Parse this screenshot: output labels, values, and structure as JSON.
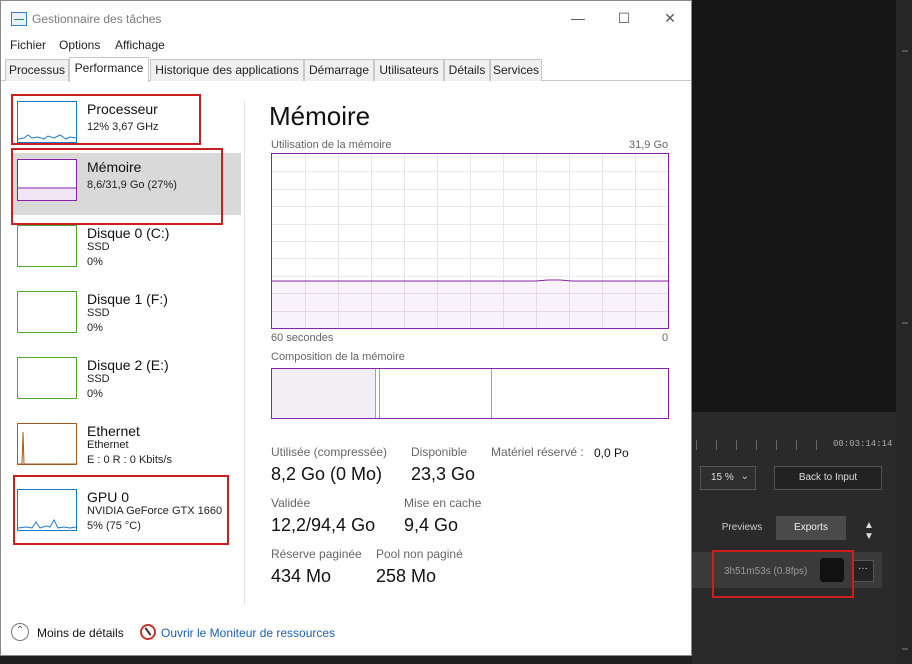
{
  "window": {
    "title": "Gestionnaire des tâches",
    "controls": {
      "minimize": "—",
      "maximize": "☐",
      "close": "✕"
    }
  },
  "menu": [
    "Fichier",
    "Options",
    "Affichage"
  ],
  "tabs": [
    {
      "label": "Processus",
      "active": false
    },
    {
      "label": "Performance",
      "active": true
    },
    {
      "label": "Historique des applications",
      "active": false
    },
    {
      "label": "Démarrage",
      "active": false
    },
    {
      "label": "Utilisateurs",
      "active": false
    },
    {
      "label": "Détails",
      "active": false
    },
    {
      "label": "Services",
      "active": false
    }
  ],
  "sidebar": {
    "items": [
      {
        "title": "Processeur",
        "line1": "12% 3,67 GHz",
        "line2": "",
        "line3": "",
        "color": "#1b7ac6"
      },
      {
        "title": "Mémoire",
        "line1": "8,6/31,9 Go (27%)",
        "line2": "",
        "line3": "",
        "color": "#8c1fa6"
      },
      {
        "title": "Disque 0 (C:)",
        "line1": "SSD",
        "line2": "0%",
        "line3": "",
        "color": "#4ea72e"
      },
      {
        "title": "Disque 1 (F:)",
        "line1": "SSD",
        "line2": "0%",
        "line3": "",
        "color": "#4ea72e"
      },
      {
        "title": "Disque 2 (E:)",
        "line1": "SSD",
        "line2": "0%",
        "line3": "",
        "color": "#4ea72e"
      },
      {
        "title": "Ethernet",
        "line1": "Ethernet",
        "line2": "E : 0 R : 0 Kbits/s",
        "line3": "",
        "color": "#a7591e"
      },
      {
        "title": "GPU 0",
        "line1": "NVIDIA GeForce GTX 1660",
        "line2": "5% (75 °C)",
        "line3": "",
        "color": "#1b7ac6"
      }
    ]
  },
  "main": {
    "title": "Mémoire",
    "usage_label": "Utilisation de la mémoire",
    "usage_max": "31,9 Go",
    "time_left": "60 secondes",
    "time_right": "0",
    "composition_label": "Composition de la mémoire",
    "usage_fraction": 0.27,
    "stats": {
      "used_label": "Utilisée (compressée)",
      "used_value": "8,2 Go (0 Mo)",
      "available_label": "Disponible",
      "available_value": "23,3 Go",
      "reserved_label": "Matériel réservé :",
      "reserved_value": "0,0 Po",
      "committed_label": "Validée",
      "committed_value": "12,2/94,4 Go",
      "cached_label": "Mise en cache",
      "cached_value": "9,4 Go",
      "paged_label": "Réserve paginée",
      "paged_value": "434 Mo",
      "nonpaged_label": "Pool non paginé",
      "nonpaged_value": "258 Mo"
    }
  },
  "footer": {
    "fewer_details": "Moins de détails",
    "resource_monitor": "Ouvrir le Moniteur de ressources"
  },
  "background_app": {
    "timecode": "00:03:14:14",
    "zoom": "15 %",
    "back_button": "Back to Input",
    "tab_previews": "Previews",
    "tab_exports": "Exports",
    "export_status": "3h51m53s (0.8fps)",
    "more": "···"
  },
  "colors": {
    "memory": "#8c1fa6",
    "highlight_red": "#cc1e1e"
  }
}
